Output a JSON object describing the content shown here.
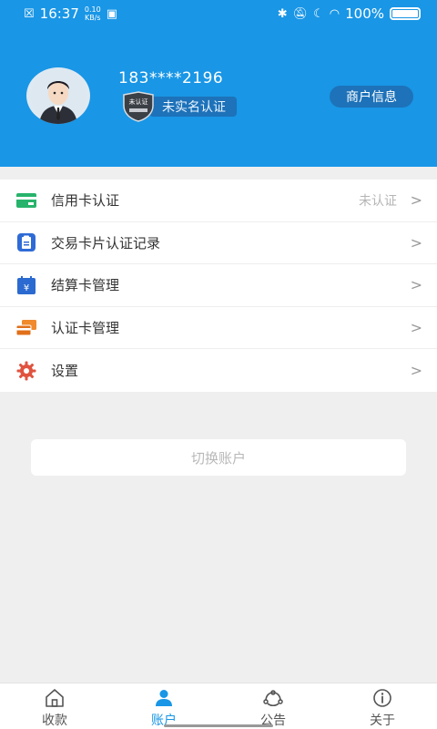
{
  "status_bar": {
    "time": "16:37",
    "speed": "0.10",
    "speed_unit": "KB/s",
    "battery": "100%"
  },
  "profile": {
    "phone": "183****2196",
    "shield_text": "未认证",
    "cert_status": "未实名认证",
    "merchant_button": "商户信息"
  },
  "menu": {
    "items": [
      {
        "label": "信用卡认证",
        "value": "未认证",
        "icon": "credit-card-icon"
      },
      {
        "label": "交易卡片认证记录",
        "value": "",
        "icon": "clipboard-icon"
      },
      {
        "label": "结算卡管理",
        "value": "",
        "icon": "calendar-yuan-icon"
      },
      {
        "label": "认证卡管理",
        "value": "",
        "icon": "cards-stack-icon"
      },
      {
        "label": "设置",
        "value": "",
        "icon": "gear-icon"
      }
    ],
    "chevron": ">"
  },
  "switch_account": "切换账户",
  "tabs": [
    {
      "label": "收款",
      "icon": "home-icon"
    },
    {
      "label": "账户",
      "icon": "user-icon",
      "active": true
    },
    {
      "label": "公告",
      "icon": "announcement-icon"
    },
    {
      "label": "关于",
      "icon": "info-icon"
    }
  ],
  "colors": {
    "header": "#1996e6",
    "accent": "#1996e6",
    "pill": "#1d72b9"
  }
}
